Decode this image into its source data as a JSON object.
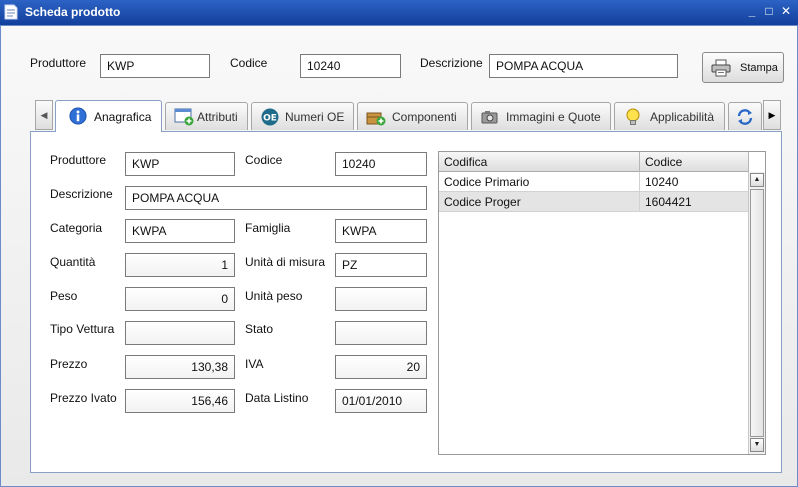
{
  "window": {
    "title": "Scheda prodotto",
    "minimize": "_",
    "maximize": "□",
    "close": "✕"
  },
  "header": {
    "produttore_label": "Produttore",
    "produttore_value": "KWP",
    "codice_label": "Codice",
    "codice_value": "10240",
    "descrizione_label": "Descrizione",
    "descrizione_value": "POMPA ACQUA",
    "print_button": "Stampa"
  },
  "tabs": [
    {
      "label": "Anagrafica",
      "icon": "info-icon",
      "active": true
    },
    {
      "label": "Attributi",
      "icon": "window-add-icon"
    },
    {
      "label": "Numeri OE",
      "icon": "oe-badge-icon",
      "badge": "OE"
    },
    {
      "label": "Componenti",
      "icon": "box-add-icon"
    },
    {
      "label": "Immagini e Quote",
      "icon": "camera-icon"
    },
    {
      "label": "Applicabilità",
      "icon": "lightbulb-icon"
    }
  ],
  "form": {
    "produttore": {
      "label": "Produttore",
      "value": "KWP"
    },
    "codice": {
      "label": "Codice",
      "value": "10240"
    },
    "descrizione": {
      "label": "Descrizione",
      "value": "POMPA ACQUA"
    },
    "categoria": {
      "label": "Categoria",
      "value": "KWPA"
    },
    "famiglia": {
      "label": "Famiglia",
      "value": "KWPA"
    },
    "quantita": {
      "label": "Quantità",
      "value": "1"
    },
    "unita_misura": {
      "label": "Unità di misura",
      "value": "PZ"
    },
    "peso": {
      "label": "Peso",
      "value": "0"
    },
    "unita_peso": {
      "label": "Unità peso",
      "value": ""
    },
    "tipo_vettura": {
      "label": "Tipo Vettura",
      "value": ""
    },
    "stato": {
      "label": "Stato",
      "value": ""
    },
    "prezzo": {
      "label": "Prezzo",
      "value": "130,38"
    },
    "iva": {
      "label": "IVA",
      "value": "20"
    },
    "prezzo_ivato": {
      "label": "Prezzo Ivato",
      "value": "156,46"
    },
    "data_listino": {
      "label": "Data Listino",
      "value": "01/01/2010"
    }
  },
  "codes_grid": {
    "columns": [
      "Codifica",
      "Codice"
    ],
    "rows": [
      [
        "Codice Primario",
        "10240"
      ],
      [
        "Codice Proger",
        "1604421"
      ]
    ]
  },
  "colors": {
    "title_bar": "#1b4cad",
    "selected_row": "#e4e4e4",
    "panel_border": "#8a9fc6"
  }
}
